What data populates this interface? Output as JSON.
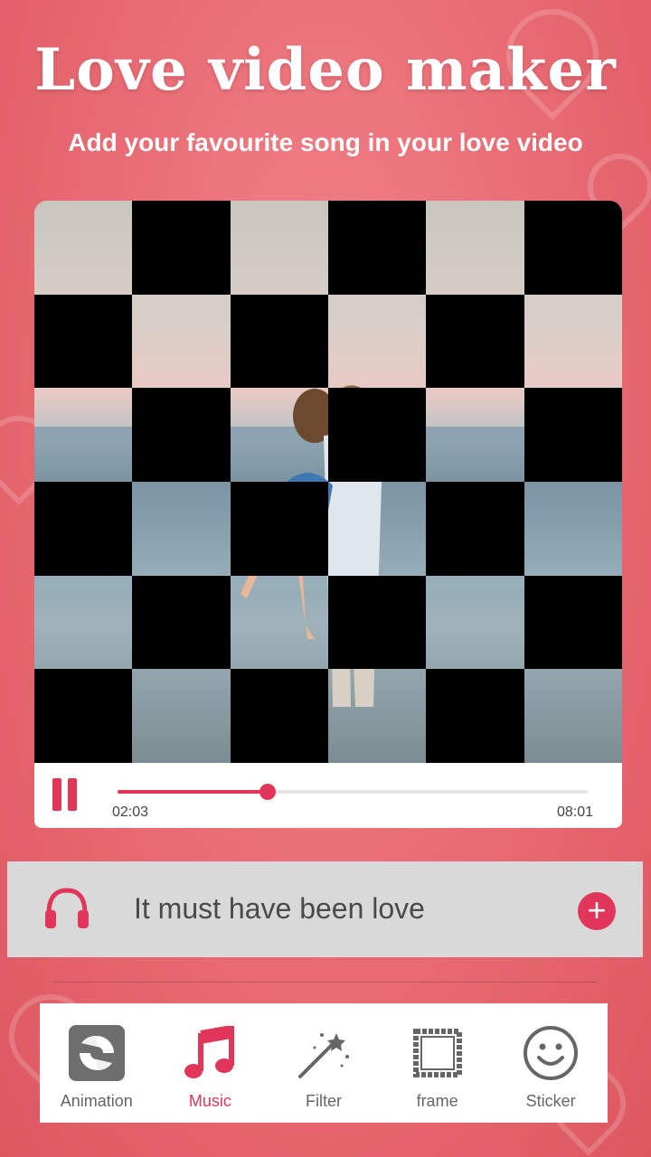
{
  "header": {
    "title": "Love video maker",
    "subtitle": "Add your favourite song in your love video"
  },
  "player": {
    "current_time": "02:03",
    "total_time": "08:01",
    "progress": 0.32,
    "state": "playing",
    "pause_icon": "pause-icon"
  },
  "song": {
    "title": "It must have been love",
    "icon": "headphones-icon",
    "add_icon": "plus-icon"
  },
  "toolbar": {
    "items": [
      {
        "label": "Animation",
        "icon": "animation-icon",
        "active": false
      },
      {
        "label": "Music",
        "icon": "music-note-icon",
        "active": true
      },
      {
        "label": "Filter",
        "icon": "magic-wand-icon",
        "active": false
      },
      {
        "label": "frame",
        "icon": "frame-icon",
        "active": false
      },
      {
        "label": "Sticker",
        "icon": "smiley-icon",
        "active": false
      }
    ]
  },
  "colors": {
    "accent": "#e2355a",
    "background": "#e86a72"
  }
}
